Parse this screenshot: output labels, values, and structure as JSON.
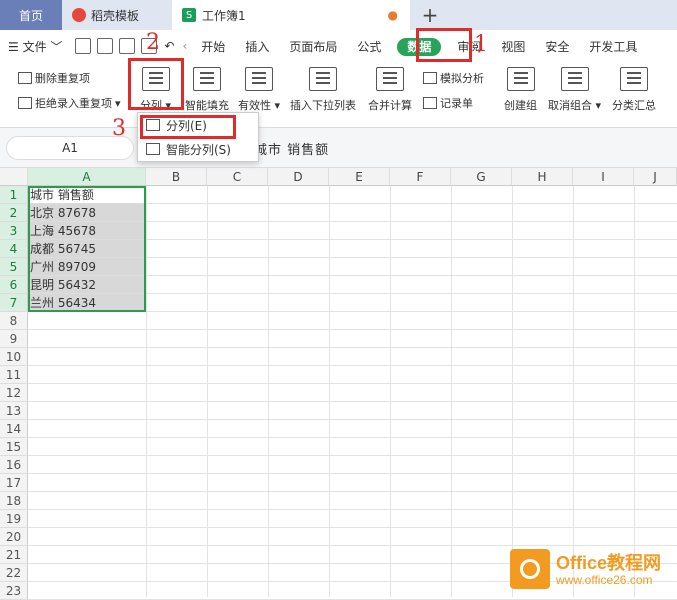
{
  "tabs": {
    "home": "首页",
    "docer": "稻壳模板",
    "workbook": "工作簿1",
    "plus": "+"
  },
  "menu": {
    "file": "文件",
    "items": [
      "开始",
      "插入",
      "页面布局",
      "公式",
      "数据",
      "审阅",
      "视图",
      "安全",
      "开发工具"
    ],
    "active": "数据"
  },
  "ribbon": {
    "remove_dup": "删除重复项",
    "reject_dup": "拒绝录入重复项",
    "split": "分列",
    "smart_fill": "智能填充",
    "validity": "有效性",
    "insert_dropdown": "插入下拉列表",
    "merge_calc": "合并计算",
    "simulate": "模拟分析",
    "record": "记录单",
    "create_group": "创建组",
    "ungroup": "取消组合",
    "subtotal": "分类汇总"
  },
  "dropdown": {
    "split": "分列(E)",
    "smart_split": "智能分列(S)"
  },
  "formula_bar": {
    "name_box": "A1",
    "value": "城市  销售额"
  },
  "columns": [
    "A",
    "B",
    "C",
    "D",
    "E",
    "F",
    "G",
    "H",
    "I",
    "J"
  ],
  "rows": [
    "1",
    "2",
    "3",
    "4",
    "5",
    "6",
    "7",
    "8",
    "9",
    "10",
    "11",
    "12",
    "13",
    "14",
    "15",
    "16",
    "17",
    "18",
    "19",
    "20",
    "21",
    "22",
    "23"
  ],
  "cells_a": [
    "城市   销售额",
    "北京   87678",
    "上海   45678",
    "成都   56745",
    "广州   89709",
    "昆明   56432",
    "兰州   56434"
  ],
  "annotations": {
    "step1": "1",
    "step2": "2",
    "step3": "3"
  },
  "watermark": {
    "title": "Office教程网",
    "url": "www.office26.com"
  },
  "colors": {
    "accent": "#27a35a",
    "annotation": "#e02b2b",
    "watermark": "#f39b21"
  }
}
